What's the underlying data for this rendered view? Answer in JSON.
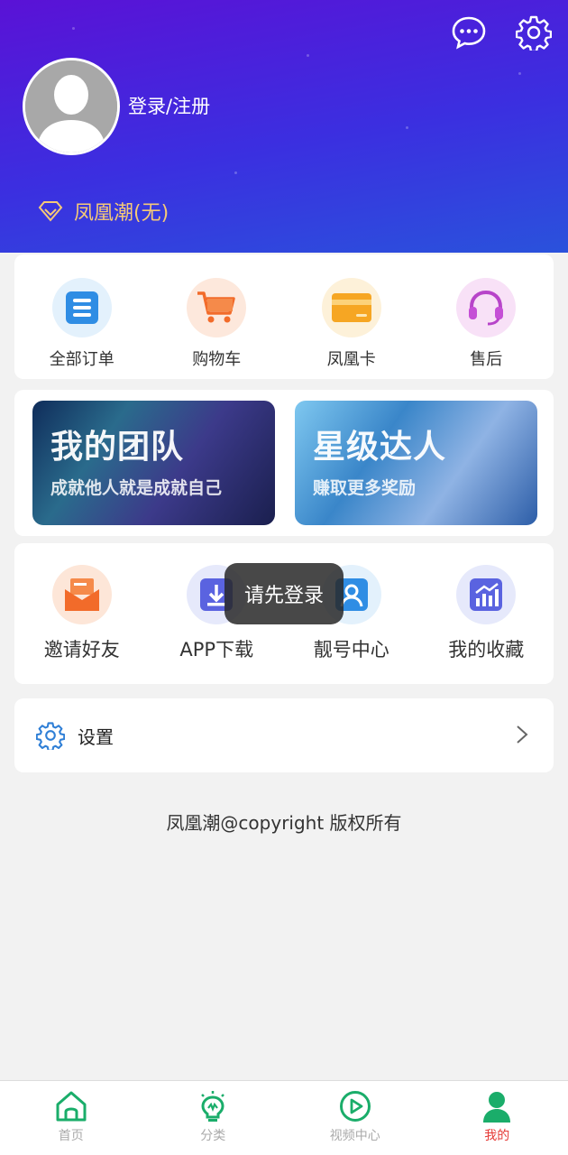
{
  "header": {
    "login_label": "登录/注册",
    "member_label": "凤凰潮(无)",
    "icons": [
      "chat-icon",
      "gear-icon"
    ]
  },
  "orders": [
    {
      "label": "全部订单",
      "icon": "order-list-icon"
    },
    {
      "label": "购物车",
      "icon": "cart-icon"
    },
    {
      "label": "凤凰卡",
      "icon": "card-icon"
    },
    {
      "label": "售后",
      "icon": "headset-icon"
    }
  ],
  "banners": [
    {
      "title": "我的团队",
      "subtitle": "成就他人就是成就自己"
    },
    {
      "title": "星级达人",
      "subtitle": "赚取更多奖励"
    }
  ],
  "services": [
    {
      "label": "邀请好友",
      "icon": "mail-icon"
    },
    {
      "label": "APP下载",
      "icon": "download-icon"
    },
    {
      "label": "靓号中心",
      "icon": "id-card-icon"
    },
    {
      "label": "我的收藏",
      "icon": "chart-icon"
    }
  ],
  "toast": "请先登录",
  "settings": {
    "label": "设置"
  },
  "footer": {
    "copyright": "凤凰潮@copyright 版权所有"
  },
  "tabbar": [
    {
      "label": "首页",
      "icon": "home-icon"
    },
    {
      "label": "分类",
      "icon": "bulb-icon"
    },
    {
      "label": "视频中心",
      "icon": "play-icon"
    },
    {
      "label": "我的",
      "icon": "user-icon",
      "active": true
    }
  ],
  "colors": {
    "accent_green": "#1aad6a",
    "active_tab": "#e53935",
    "member_gold": "#f5c978"
  }
}
